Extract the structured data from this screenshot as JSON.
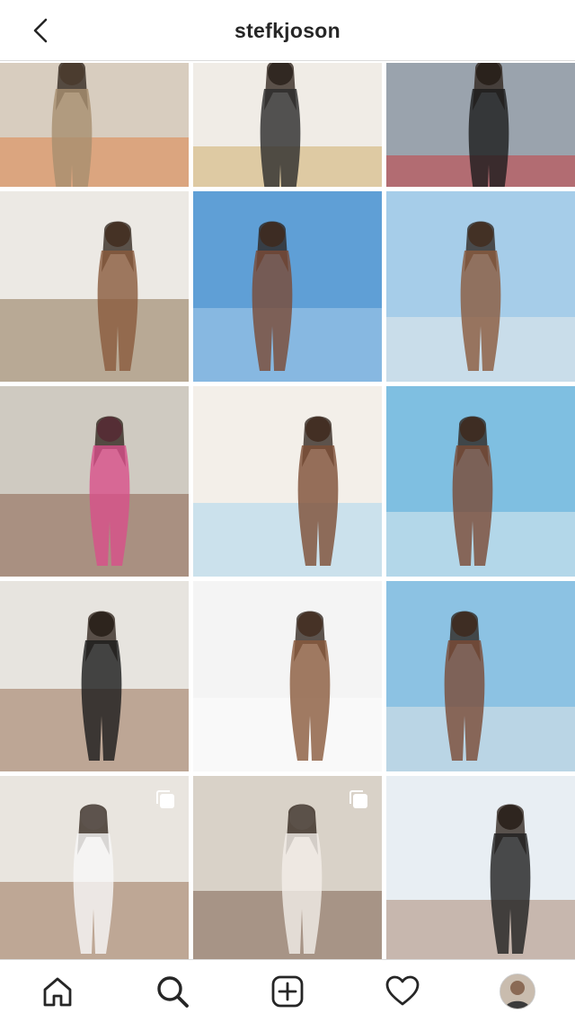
{
  "header": {
    "username": "stefkjoson",
    "back_icon": "chevron-left-icon"
  },
  "grid": {
    "posts": [
      {
        "bg": "#d8cdbf",
        "fg": "#a88e6f",
        "accent": "#e07530",
        "multi": false
      },
      {
        "bg": "#f0ece6",
        "fg": "#2b2b2b",
        "accent": "#c8a153",
        "multi": false
      },
      {
        "bg": "#9aa3ad",
        "fg": "#1c1c1c",
        "accent": "#d12a2a",
        "multi": false
      },
      {
        "bg": "#ece9e4",
        "fg": "#8a5a3c",
        "accent": "#7a5a36",
        "multi": false
      },
      {
        "bg": "#5f9fd6",
        "fg": "#7b4a34",
        "accent": "#b9d8ef",
        "multi": false
      },
      {
        "bg": "#a6cde9",
        "fg": "#8b5a3c",
        "accent": "#f5f1ea",
        "multi": false
      },
      {
        "bg": "#cfcac1",
        "fg": "#d84f8a",
        "accent": "#7b4a34",
        "multi": false
      },
      {
        "bg": "#f3efe9",
        "fg": "#7d4e34",
        "accent": "#9bd0ef",
        "multi": false
      },
      {
        "bg": "#7fbfe1",
        "fg": "#7b4a34",
        "accent": "#f3f3f3",
        "multi": false
      },
      {
        "bg": "#e7e4df",
        "fg": "#1a1a1a",
        "accent": "#8a5a3c",
        "multi": false
      },
      {
        "bg": "#f4f4f4",
        "fg": "#8a5a3c",
        "accent": "#ffffff",
        "multi": false
      },
      {
        "bg": "#8cc2e3",
        "fg": "#7b4a34",
        "accent": "#f1ede6",
        "multi": false
      },
      {
        "bg": "#e9e5df",
        "fg": "#f7f7f7",
        "accent": "#8a5a3c",
        "multi": true
      },
      {
        "bg": "#d9d2c8",
        "fg": "#f2eee8",
        "accent": "#6b4a36",
        "multi": true
      },
      {
        "bg": "#e8eef3",
        "fg": "#1f1f1f",
        "accent": "#a0745a",
        "multi": false
      }
    ]
  },
  "nav": {
    "items": [
      {
        "icon": "home-icon"
      },
      {
        "icon": "search-icon"
      },
      {
        "icon": "add-post-icon"
      },
      {
        "icon": "heart-icon"
      },
      {
        "icon": "profile-avatar"
      }
    ]
  }
}
